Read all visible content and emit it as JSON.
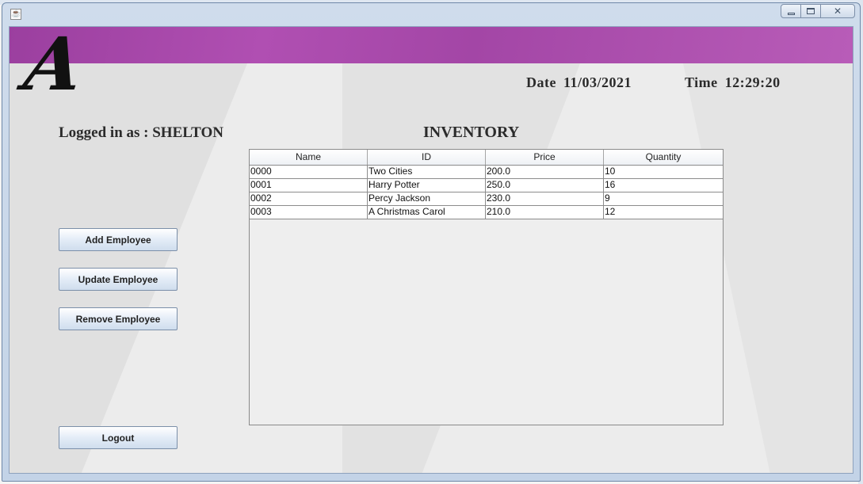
{
  "window": {
    "app_icon": "java-cup-icon",
    "controls": [
      "minimize-icon",
      "maximize-icon",
      "close-icon"
    ]
  },
  "header": {
    "logo_letter": "A",
    "date_label": "Date",
    "date_value": "11/03/2021",
    "time_label": "Time",
    "time_value": "12:29:20",
    "accent_color": "#b04fb2"
  },
  "user": {
    "label": "Logged in as : SHELTON"
  },
  "inventory": {
    "title": "INVENTORY",
    "columns": [
      "Name",
      "ID",
      "Price",
      "Quantity"
    ],
    "rows": [
      [
        "0000",
        "Two Cities",
        "200.0",
        "10"
      ],
      [
        "0001",
        "Harry Potter",
        "250.0",
        "16"
      ],
      [
        "0002",
        "Percy Jackson",
        "230.0",
        "9"
      ],
      [
        "0003",
        "A Christmas Carol",
        "210.0",
        "12"
      ]
    ]
  },
  "buttons": {
    "add": "Add Employee",
    "update": "Update Employee",
    "remove": "Remove Employee",
    "logout": "Logout"
  }
}
